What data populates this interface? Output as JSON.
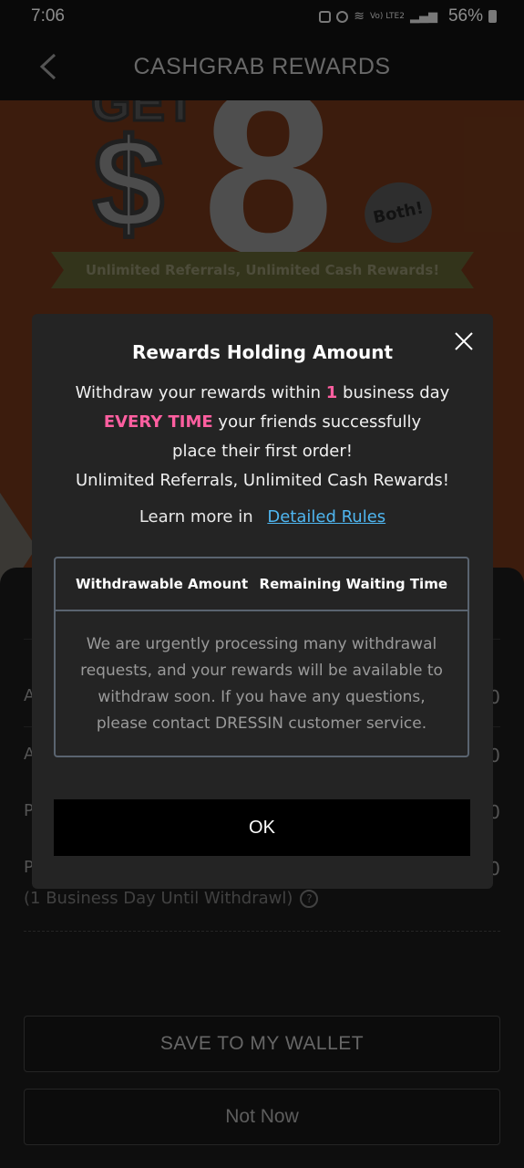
{
  "status_bar": {
    "time": "7:06",
    "network": "Vo) LTE2",
    "battery": "56%"
  },
  "header": {
    "title": "CASHGRAB REWARDS",
    "back_icon": "chevron-left-icon"
  },
  "banner": {
    "get": "GET",
    "currency": "$",
    "amount": "8",
    "badge": "Both!",
    "ribbon": "Unlimited Referrals, Unlimited Cash Rewards!"
  },
  "sheet": {
    "rows": [
      {
        "letter": "A",
        "value": "0"
      },
      {
        "letter": "A",
        "value": "0"
      },
      {
        "letter": "P",
        "value": "0"
      },
      {
        "letter": "P",
        "value": "0"
      }
    ],
    "note": "(1 Business Day Until Withdrawl)",
    "help_icon": "question-circle-icon",
    "save_button": "SAVE TO MY WALLET",
    "not_now_button": "Not Now"
  },
  "modal": {
    "title": "Rewards Holding Amount",
    "close_icon": "close-icon",
    "line1_pre": "Withdraw your rewards within ",
    "line1_highlight": "1",
    "line1_post": " business day",
    "line2_highlight": "EVERY TIME",
    "line2_post": " your friends successfully",
    "line3": "place their first order!",
    "line4": "Unlimited Referrals, Unlimited Cash Rewards!",
    "learn_pre": "Learn more in",
    "learn_link": "Detailed Rules",
    "table_headers": [
      "Withdrawable Amount",
      "Remaining Waiting Time"
    ],
    "table_message": "We are urgently processing many withdrawal requests, and your rewards will be available to withdraw soon. If you have any questions, please contact DRESSIN customer service.",
    "ok_button": "OK"
  },
  "colors": {
    "accent_pink": "#ff5fa0",
    "link_blue": "#4fb6f0",
    "banner_orange": "#6e3418"
  }
}
